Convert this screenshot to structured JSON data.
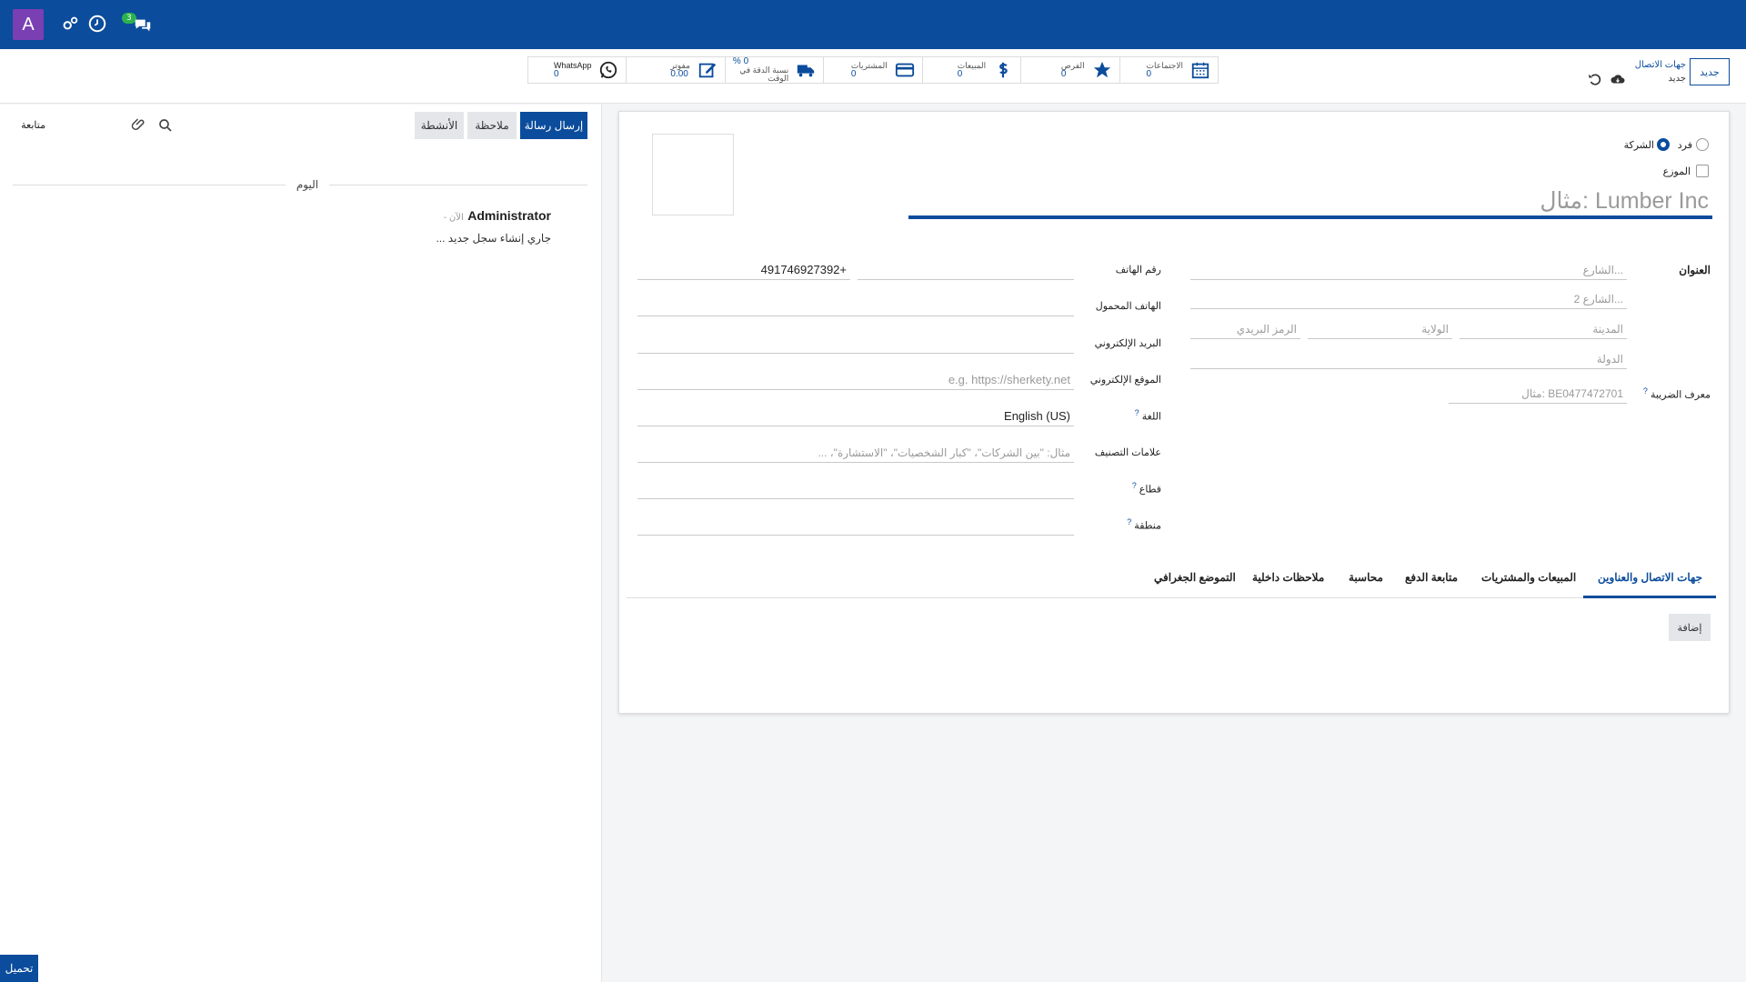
{
  "navbar": {
    "avatar_letter": "A",
    "messages_badge": "3"
  },
  "control": {
    "breadcrumb_parent": "جهات الاتصال",
    "breadcrumb_current": "جديد",
    "new_button": "جديد",
    "stats": [
      {
        "label": "الاجتماعات",
        "value": "0",
        "icon": "calendar-icon"
      },
      {
        "label": "الفرص",
        "value": "0",
        "icon": "star-icon"
      },
      {
        "label": "المبيعات",
        "value": "0",
        "icon": "dollar-icon"
      },
      {
        "label": "المشتريات",
        "value": "0",
        "icon": "credit-card-icon"
      },
      {
        "label": "نسبة الدقة في الوقت",
        "value": "0 %",
        "icon": "truck-icon"
      },
      {
        "label": "مفوتر",
        "value": "0.00",
        "icon": "edit-icon"
      },
      {
        "label": "WhatsApp",
        "value": "0",
        "icon": "whatsapp-icon"
      }
    ]
  },
  "form": {
    "type_individual": "فرد",
    "type_company": "الشركة",
    "distributor_label": "الموزع",
    "name_placeholder": "مثال: Lumber Inc",
    "address_label": "العنوان",
    "street_placeholder": "الشارع...",
    "street2_placeholder": "الشارع 2...",
    "city_placeholder": "المدينة",
    "state_placeholder": "الولاية",
    "zip_placeholder": "الرمز البريدي",
    "country_placeholder": "الدولة",
    "vat_label": "معرف الضريبة",
    "vat_placeholder": "مثال: BE0477472701",
    "phone_label": "رقم الهاتف",
    "phone_value": "491746927392+",
    "mobile_label": "الهاتف المحمول",
    "email_label": "البريد الإلكتروني",
    "website_label": "الموقع الإلكتروني",
    "website_placeholder": "e.g. https://sherkety.net",
    "language_label": "اللغة",
    "language_value": "English (US)",
    "tags_label": "علامات التصنيف",
    "tags_placeholder": "مثال: \"بين الشركات\"، \"كبار الشخصيات\"، \"الاستشارة\"، ...",
    "sector_label": "قطاع",
    "region_label": "منطقة",
    "tabs": [
      "جهات الاتصال والعناوين",
      "المبيعات والمشتريات",
      "متابعة الدفع",
      "محاسبة",
      "ملاحظات داخلية",
      "التموضع الجغرافي"
    ],
    "add_button": "إضافة"
  },
  "chatter": {
    "send_message": "إرسال رسالة",
    "log_note": "ملاحظة",
    "activities": "الأنشطة",
    "follow": "متابعة",
    "date_separator": "اليوم",
    "author": "Administrator",
    "time": "- الآن",
    "message": "جاري إنشاء سجل جديد ..."
  },
  "bottom_button": "تحميل",
  "colors": {
    "navbar": "#0b4c9c",
    "avatar": "#7a3fb3",
    "badge": "#2bb24c"
  }
}
